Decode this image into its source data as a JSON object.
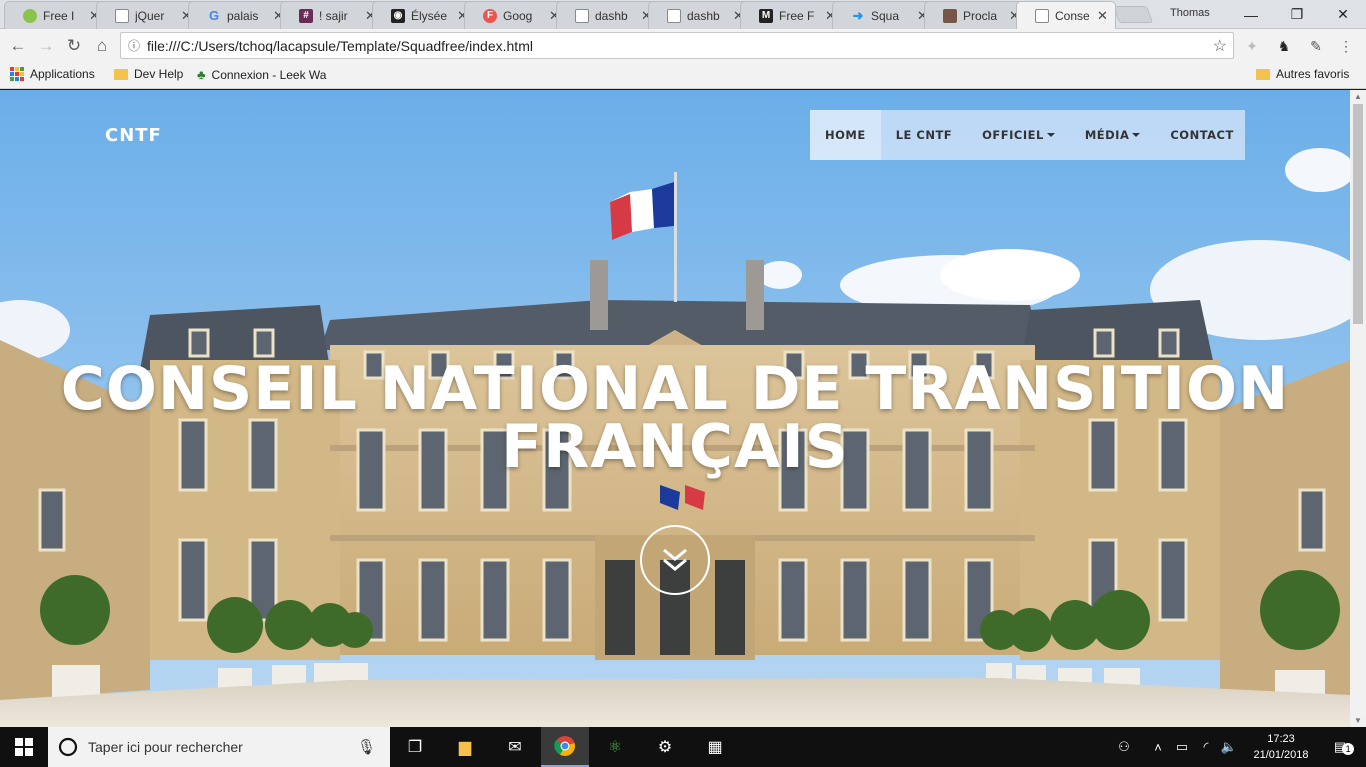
{
  "browser": {
    "tabs": [
      {
        "title": "Free I",
        "icon": "lime-icon",
        "color": "#8bc34a"
      },
      {
        "title": "jQuer",
        "icon": "page-icon",
        "color": "#9e9e9e"
      },
      {
        "title": "palais",
        "icon": "google-icon",
        "color": "#4285f4"
      },
      {
        "title": "! sajir",
        "icon": "slack-icon",
        "color": "#6b2b57"
      },
      {
        "title": "Élysée",
        "icon": "camera-icon",
        "color": "#222222"
      },
      {
        "title": "Goog",
        "icon": "fonts-icon",
        "color": "#ef5350"
      },
      {
        "title": "dashb",
        "icon": "page-icon",
        "color": "#9e9e9e"
      },
      {
        "title": "dashb",
        "icon": "page-icon",
        "color": "#9e9e9e"
      },
      {
        "title": "Free F",
        "icon": "medium-icon",
        "color": "#222222"
      },
      {
        "title": "Squa",
        "icon": "squad-icon",
        "color": "#2196f3"
      },
      {
        "title": "Procla",
        "icon": "image-icon",
        "color": "#795548"
      },
      {
        "title": "Conse",
        "icon": "page-icon",
        "color": "#9e9e9e",
        "active": true
      }
    ],
    "profile": "Thomas",
    "url": "file:///C:/Users/tchoq/lacapsule/Template/Squadfree/index.html",
    "bookmarks": {
      "apps": "Applications",
      "dev_help": "Dev Help",
      "leek": "Connexion - Leek Wa",
      "other": "Autres favoris"
    }
  },
  "page": {
    "brand": "CNTF",
    "menu": [
      {
        "label": "HOME",
        "active": true
      },
      {
        "label": "LE CNTF"
      },
      {
        "label": "OFFICIEL",
        "dropdown": true
      },
      {
        "label": "MÉDIA",
        "dropdown": true
      },
      {
        "label": "CONTACT"
      }
    ],
    "hero_line1": "CONSEIL NATIONAL DE TRANSITION",
    "hero_line2": "FRANÇAIS"
  },
  "taskbar": {
    "search_placeholder": "Taper ici pour rechercher",
    "time": "17:23",
    "date": "21/01/2018",
    "notifications": "1"
  },
  "colors": {
    "sky_top": "#6fb2ea",
    "facade": "#d7bb8a",
    "roof": "#4f5863",
    "menu_bg": "#cce0f8"
  }
}
